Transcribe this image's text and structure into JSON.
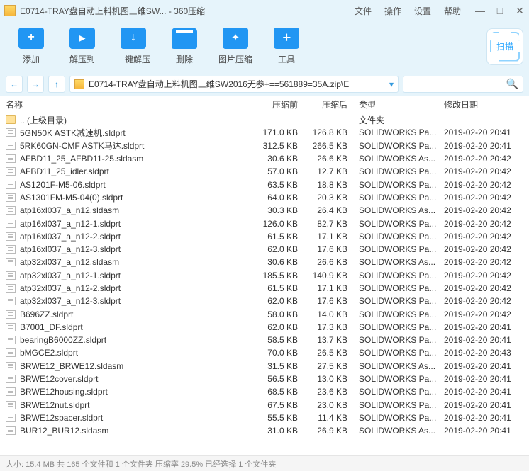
{
  "window": {
    "title": "E0714-TRAY盘自动上料机图三维SW... - 360压缩"
  },
  "menu": {
    "file": "文件",
    "operate": "操作",
    "settings": "设置",
    "help": "帮助"
  },
  "winctl": {
    "min": "—",
    "max": "□",
    "close": "✕"
  },
  "toolbar": {
    "add": "添加",
    "extract": "解压到",
    "oneclick": "一键解压",
    "delete": "删除",
    "image": "图片压缩",
    "tools": "工具",
    "scan": "扫描"
  },
  "nav": {
    "back": "←",
    "fwd": "→",
    "up": "↑"
  },
  "address": {
    "path": "E0714-TRAY盘自动上料机图三维SW2016无参+==561889=35A.zip\\E",
    "drop": "▾"
  },
  "columns": {
    "name": "名称",
    "before": "压缩前",
    "after": "压缩后",
    "type": "类型",
    "date": "修改日期"
  },
  "files": [
    {
      "icon": "fold",
      "name": ".. (上级目录)",
      "before": "",
      "after": "",
      "type": "文件夹",
      "date": ""
    },
    {
      "icon": "file",
      "name": "5GN50K ASTK减速机.sldprt",
      "before": "171.0 KB",
      "after": "126.8 KB",
      "type": "SOLIDWORKS Pa...",
      "date": "2019-02-20 20:41"
    },
    {
      "icon": "file",
      "name": "5RK60GN-CMF ASTK马达.sldprt",
      "before": "312.5 KB",
      "after": "266.5 KB",
      "type": "SOLIDWORKS Pa...",
      "date": "2019-02-20 20:41"
    },
    {
      "icon": "file",
      "name": "AFBD11_25_AFBD11-25.sldasm",
      "before": "30.6 KB",
      "after": "26.6 KB",
      "type": "SOLIDWORKS As...",
      "date": "2019-02-20 20:42"
    },
    {
      "icon": "file",
      "name": "AFBD11_25_idler.sldprt",
      "before": "57.0 KB",
      "after": "12.7 KB",
      "type": "SOLIDWORKS Pa...",
      "date": "2019-02-20 20:42"
    },
    {
      "icon": "file",
      "name": "AS1201F-M5-06.sldprt",
      "before": "63.5 KB",
      "after": "18.8 KB",
      "type": "SOLIDWORKS Pa...",
      "date": "2019-02-20 20:42"
    },
    {
      "icon": "file",
      "name": "AS1301FM-M5-04(0).sldprt",
      "before": "64.0 KB",
      "after": "20.3 KB",
      "type": "SOLIDWORKS Pa...",
      "date": "2019-02-20 20:42"
    },
    {
      "icon": "file",
      "name": "atp16xl037_a_n12.sldasm",
      "before": "30.3 KB",
      "after": "26.4 KB",
      "type": "SOLIDWORKS As...",
      "date": "2019-02-20 20:42"
    },
    {
      "icon": "file",
      "name": "atp16xl037_a_n12-1.sldprt",
      "before": "126.0 KB",
      "after": "82.7 KB",
      "type": "SOLIDWORKS Pa...",
      "date": "2019-02-20 20:42"
    },
    {
      "icon": "file",
      "name": "atp16xl037_a_n12-2.sldprt",
      "before": "61.5 KB",
      "after": "17.1 KB",
      "type": "SOLIDWORKS Pa...",
      "date": "2019-02-20 20:42"
    },
    {
      "icon": "file",
      "name": "atp16xl037_a_n12-3.sldprt",
      "before": "62.0 KB",
      "after": "17.6 KB",
      "type": "SOLIDWORKS Pa...",
      "date": "2019-02-20 20:42"
    },
    {
      "icon": "file",
      "name": "atp32xl037_a_n12.sldasm",
      "before": "30.6 KB",
      "after": "26.6 KB",
      "type": "SOLIDWORKS As...",
      "date": "2019-02-20 20:42"
    },
    {
      "icon": "file",
      "name": "atp32xl037_a_n12-1.sldprt",
      "before": "185.5 KB",
      "after": "140.9 KB",
      "type": "SOLIDWORKS Pa...",
      "date": "2019-02-20 20:42"
    },
    {
      "icon": "file",
      "name": "atp32xl037_a_n12-2.sldprt",
      "before": "61.5 KB",
      "after": "17.1 KB",
      "type": "SOLIDWORKS Pa...",
      "date": "2019-02-20 20:42"
    },
    {
      "icon": "file",
      "name": "atp32xl037_a_n12-3.sldprt",
      "before": "62.0 KB",
      "after": "17.6 KB",
      "type": "SOLIDWORKS Pa...",
      "date": "2019-02-20 20:42"
    },
    {
      "icon": "file",
      "name": "B696ZZ.sldprt",
      "before": "58.0 KB",
      "after": "14.0 KB",
      "type": "SOLIDWORKS Pa...",
      "date": "2019-02-20 20:42"
    },
    {
      "icon": "file",
      "name": "B7001_DF.sldprt",
      "before": "62.0 KB",
      "after": "17.3 KB",
      "type": "SOLIDWORKS Pa...",
      "date": "2019-02-20 20:41"
    },
    {
      "icon": "file",
      "name": "bearingB6000ZZ.sldprt",
      "before": "58.5 KB",
      "after": "13.7 KB",
      "type": "SOLIDWORKS Pa...",
      "date": "2019-02-20 20:41"
    },
    {
      "icon": "file",
      "name": "bMGCE2.sldprt",
      "before": "70.0 KB",
      "after": "26.5 KB",
      "type": "SOLIDWORKS Pa...",
      "date": "2019-02-20 20:43"
    },
    {
      "icon": "file",
      "name": "BRWE12_BRWE12.sldasm",
      "before": "31.5 KB",
      "after": "27.5 KB",
      "type": "SOLIDWORKS As...",
      "date": "2019-02-20 20:41"
    },
    {
      "icon": "file",
      "name": "BRWE12cover.sldprt",
      "before": "56.5 KB",
      "after": "13.0 KB",
      "type": "SOLIDWORKS Pa...",
      "date": "2019-02-20 20:41"
    },
    {
      "icon": "file",
      "name": "BRWE12housing.sldprt",
      "before": "68.5 KB",
      "after": "23.6 KB",
      "type": "SOLIDWORKS Pa...",
      "date": "2019-02-20 20:41"
    },
    {
      "icon": "file",
      "name": "BRWE12nut.sldprt",
      "before": "67.5 KB",
      "after": "23.0 KB",
      "type": "SOLIDWORKS Pa...",
      "date": "2019-02-20 20:41"
    },
    {
      "icon": "file",
      "name": "BRWE12spacer.sldprt",
      "before": "55.5 KB",
      "after": "11.4 KB",
      "type": "SOLIDWORKS Pa...",
      "date": "2019-02-20 20:41"
    },
    {
      "icon": "file",
      "name": "BUR12_BUR12.sldasm",
      "before": "31.0 KB",
      "after": "26.9 KB",
      "type": "SOLIDWORKS As...",
      "date": "2019-02-20 20:41"
    }
  ],
  "status": "大小: 15.4 MB 共 165 个文件和 1 个文件夹 压缩率 29.5%  已经选择 1 个文件夹"
}
